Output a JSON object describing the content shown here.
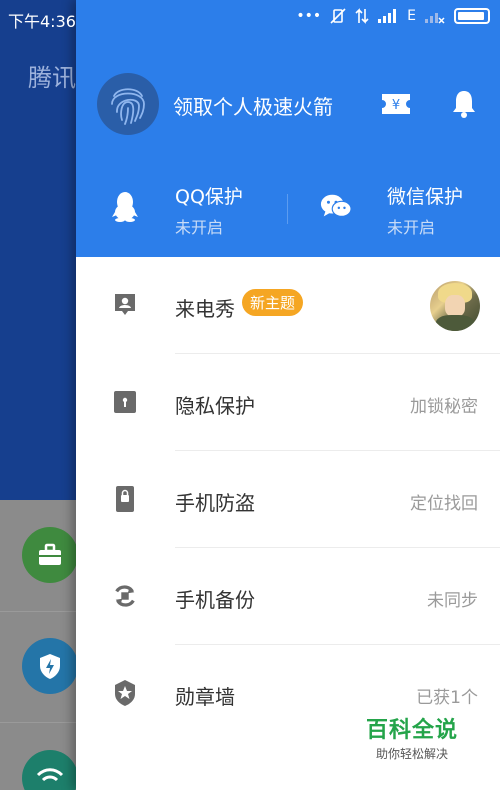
{
  "status_bar": {
    "time": "下午4:36",
    "network": "E",
    "battery_level": 0.92
  },
  "background_app": {
    "title_partial": "腾讯"
  },
  "drawer": {
    "promo_text": "领取个人极速火箭",
    "icons": {
      "avatar": "fingerprint-icon",
      "ticket": "ticket-icon",
      "bell": "bell-icon"
    },
    "protections": [
      {
        "icon": "qq-penguin-icon",
        "name": "QQ保护",
        "status": "未开启"
      },
      {
        "icon": "wechat-icon",
        "name": "微信保护",
        "status": "未开启"
      }
    ],
    "menu": [
      {
        "icon": "caller-show-icon",
        "label": "来电秀",
        "badge": "新主题",
        "value": ""
      },
      {
        "icon": "privacy-lock-icon",
        "label": "隐私保护",
        "value": "加锁秘密"
      },
      {
        "icon": "phone-lock-icon",
        "label": "手机防盗",
        "value": "定位找回"
      },
      {
        "icon": "sync-backup-icon",
        "label": "手机备份",
        "value": "未同步"
      },
      {
        "icon": "medal-icon",
        "label": "勋章墙",
        "value": "已获1个"
      }
    ]
  },
  "watermark": {
    "title": "百科全说",
    "subtitle": "助你轻松解决"
  },
  "colors": {
    "header_blue": "#2c7eea",
    "badge_orange": "#f5a623",
    "watermark_green": "#24a44a"
  }
}
